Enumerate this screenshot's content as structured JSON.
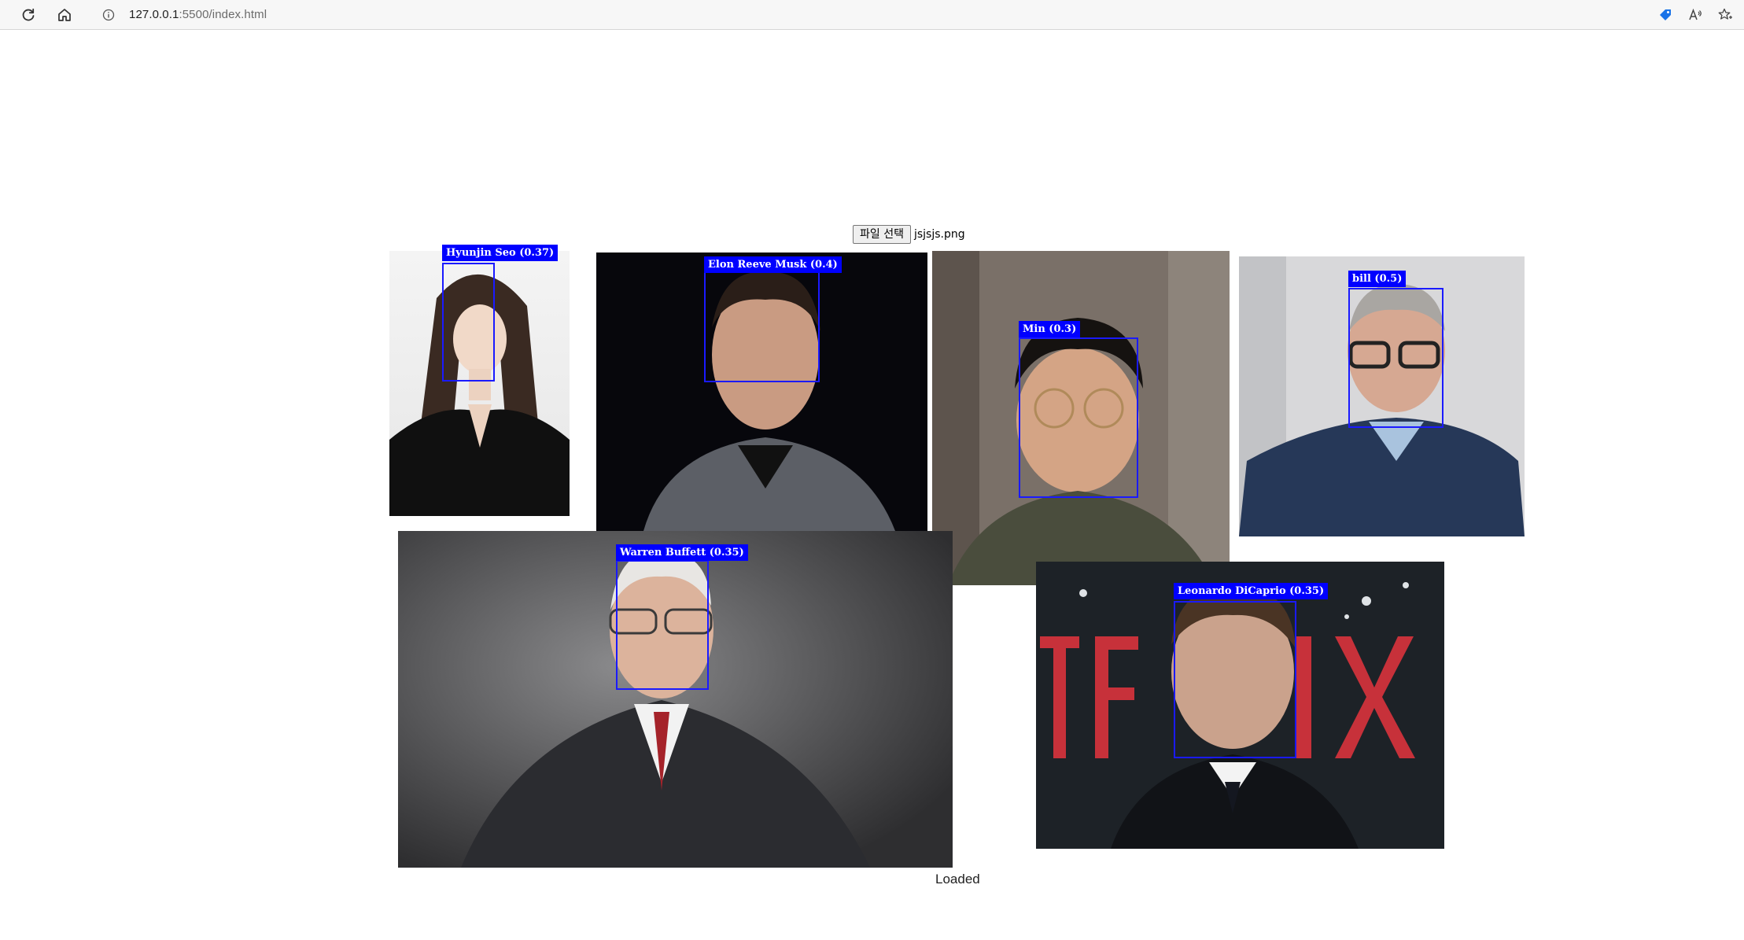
{
  "browser": {
    "url_host": "127.0.0.1",
    "url_path": ":5500/index.html",
    "icons": [
      "reload-icon",
      "home-icon",
      "info-icon",
      "tag-icon",
      "read-aloud-icon",
      "favorite-icon"
    ]
  },
  "upload": {
    "button_label": "파일 선택",
    "file_name": "jsjsjs.png"
  },
  "detections": [
    {
      "label": "Hyunjin Seo (0.37)"
    },
    {
      "label": "Elon Reeve Musk (0.4)"
    },
    {
      "label": "Min (0.3)"
    },
    {
      "label": "bill (0.5)"
    },
    {
      "label": "Warren Buffett (0.35)"
    },
    {
      "label": "Leonardo DiCaprio (0.35)"
    }
  ],
  "status_text": "Loaded",
  "colors": {
    "box": "#1a1aff",
    "label_bg": "#0000ff",
    "label_text": "#ffffff"
  }
}
